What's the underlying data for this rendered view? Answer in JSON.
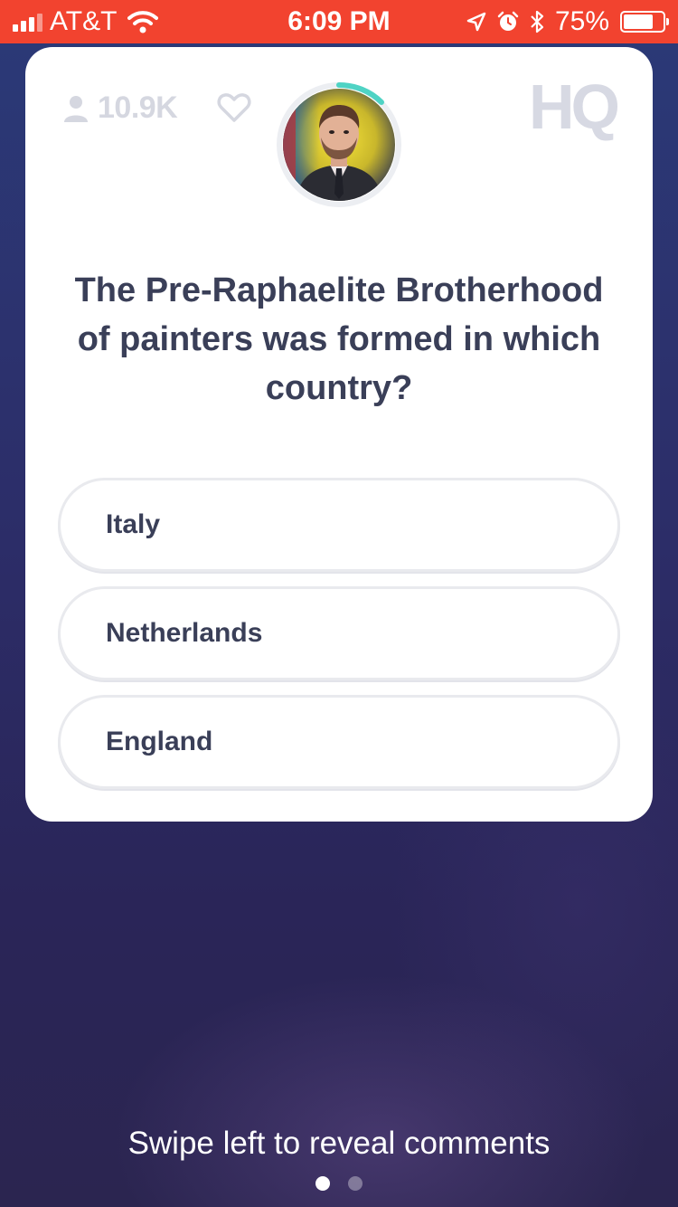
{
  "status_bar": {
    "carrier": "AT&T",
    "time": "6:09 PM",
    "battery_percent": "75%",
    "battery_level": 0.75,
    "icons": [
      "signal-icon",
      "wifi-icon",
      "location-arrow-icon",
      "alarm-icon",
      "bluetooth-icon",
      "battery-icon"
    ],
    "background_color": "#f2432f"
  },
  "card": {
    "viewer_count": "10.9K",
    "logo": "HQ",
    "question": "The Pre-Raphaelite Brotherhood of painters was formed in which country?",
    "answers": [
      {
        "label": "Italy"
      },
      {
        "label": "Netherlands"
      },
      {
        "label": "England"
      }
    ],
    "timer_color": "#4fd3c4"
  },
  "footer": {
    "swipe_hint": "Swipe left to reveal comments",
    "page_count": 2,
    "active_page": 1
  }
}
